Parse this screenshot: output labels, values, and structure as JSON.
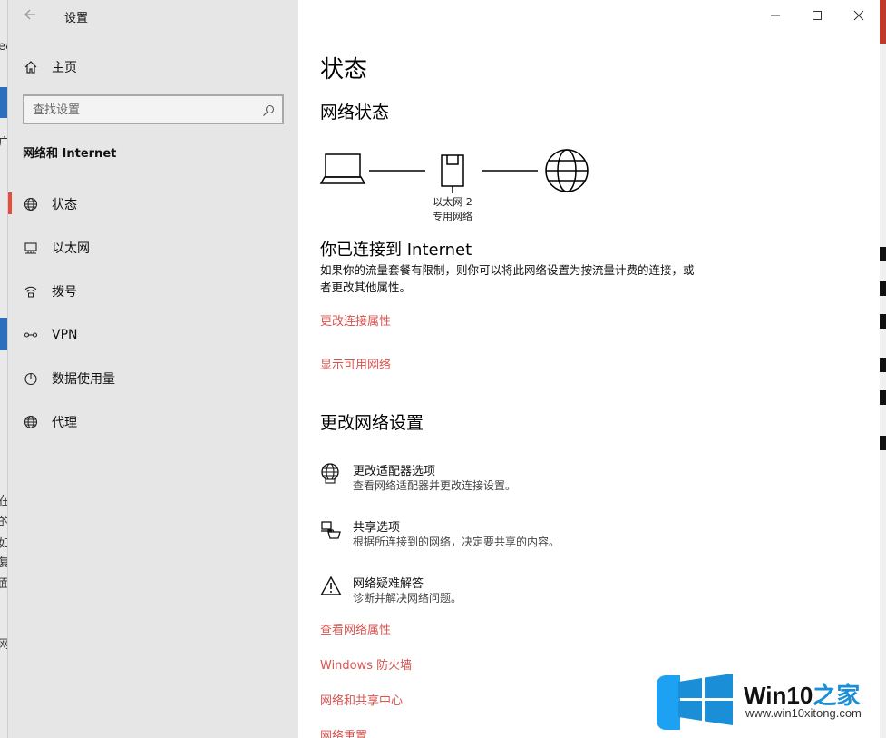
{
  "background": {
    "left_fragments": [
      "e&",
      "广",
      "在",
      "的",
      "如",
      "复",
      "面",
      "网"
    ],
    "accent": "#2a6ebd"
  },
  "window": {
    "title": "设置",
    "accent_color": "#d9534f"
  },
  "sidebar": {
    "home_label": "主页",
    "search_placeholder": "查找设置",
    "section_title": "网络和 Internet",
    "items": [
      {
        "label": "状态",
        "icon": "globe-icon"
      },
      {
        "label": "以太网",
        "icon": "ethernet-icon"
      },
      {
        "label": "拨号",
        "icon": "dialup-icon"
      },
      {
        "label": "VPN",
        "icon": "vpn-icon"
      },
      {
        "label": "数据使用量",
        "icon": "pie-chart-icon"
      },
      {
        "label": "代理",
        "icon": "globe-icon"
      }
    ]
  },
  "main": {
    "page_title": "状态",
    "network_status_heading": "网络状态",
    "diagram": {
      "adapter_name": "以太网 2",
      "network_type": "专用网络"
    },
    "connected_heading": "你已连接到 Internet",
    "connected_desc": "如果你的流量套餐有限制，则你可以将此网络设置为按流量计费的连接，或者更改其他属性。",
    "link_change_props": "更改连接属性",
    "link_show_networks": "显示可用网络",
    "change_settings_heading": "更改网络设置",
    "options": [
      {
        "title": "更改适配器选项",
        "subtitle": "查看网络适配器并更改连接设置。",
        "icon": "adapter-globe-icon"
      },
      {
        "title": "共享选项",
        "subtitle": "根据所连接到的网络，决定要共享的内容。",
        "icon": "sharing-icon"
      },
      {
        "title": "网络疑难解答",
        "subtitle": "诊断并解决网络问题。",
        "icon": "warning-icon"
      }
    ],
    "links": [
      "查看网络属性",
      "Windows 防火墙",
      "网络和共享中心",
      "网络重置"
    ]
  },
  "watermark": {
    "brand": "Win10",
    "brand_zh": "之家",
    "url": "www.win10xitong.com"
  }
}
